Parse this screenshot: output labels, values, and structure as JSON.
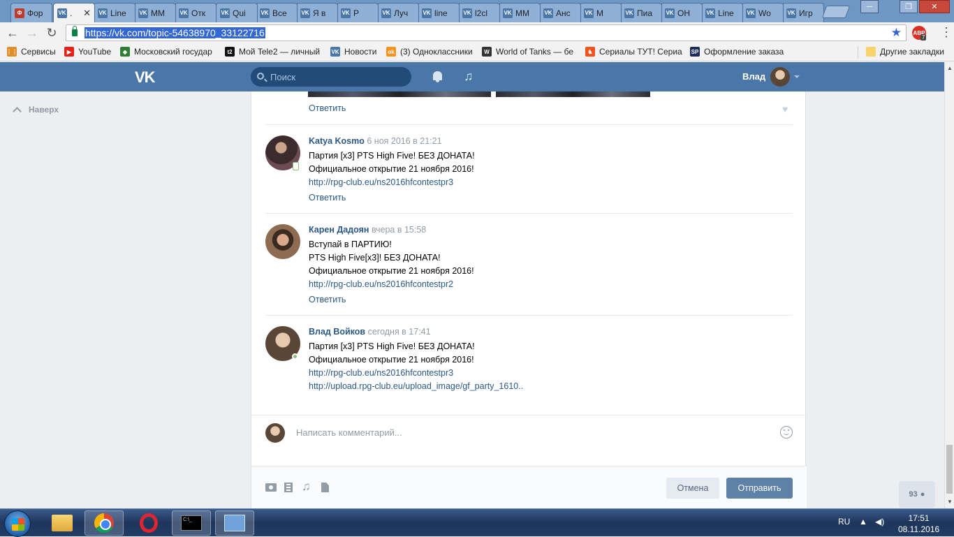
{
  "browser": {
    "tabs": [
      {
        "title": "Фор",
        "fav": "Ф"
      },
      {
        "title": ".",
        "fav": "VK",
        "active": true
      },
      {
        "title": "Line",
        "fav": "VK"
      },
      {
        "title": "MM",
        "fav": "VK"
      },
      {
        "title": "Отк",
        "fav": "VK"
      },
      {
        "title": "Qui",
        "fav": "VK"
      },
      {
        "title": "Все",
        "fav": "VK"
      },
      {
        "title": "Я в",
        "fav": "VK"
      },
      {
        "title": "Р",
        "fav": "VK"
      },
      {
        "title": "Луч",
        "fav": "VK"
      },
      {
        "title": "line",
        "fav": "VK"
      },
      {
        "title": "l2cl",
        "fav": "VK"
      },
      {
        "title": "MM",
        "fav": "VK"
      },
      {
        "title": "Анс",
        "fav": "VK"
      },
      {
        "title": "М",
        "fav": "VK"
      },
      {
        "title": "Пиа",
        "fav": "VK"
      },
      {
        "title": "ОН",
        "fav": "VK"
      },
      {
        "title": "Line",
        "fav": "VK"
      },
      {
        "title": "Wo",
        "fav": "VK"
      },
      {
        "title": "Игр",
        "fav": "VK"
      }
    ],
    "tab_close": "✕",
    "url": "https://vk.com/topic-54638970_33122716",
    "abp_label": "ABP",
    "abp_count": "7",
    "bookmarks": [
      {
        "label": "Сервисы",
        "icon": "apps-icon"
      },
      {
        "label": "YouTube",
        "icon": "youtube-icon"
      },
      {
        "label": "Московский государ",
        "icon": "msu-icon"
      },
      {
        "label": "Мой Tele2 — личный",
        "icon": "tele2-icon"
      },
      {
        "label": "Новости",
        "icon": "vk-icon"
      },
      {
        "label": "(3) Одноклассники",
        "icon": "ok-icon"
      },
      {
        "label": "World of Tanks — бе",
        "icon": "wot-icon"
      },
      {
        "label": "Сериалы ТУТ! Сериа",
        "icon": "serials-icon"
      },
      {
        "label": "Оформление заказа",
        "icon": "sp-icon"
      }
    ],
    "other_bookmarks": "Другие закладки"
  },
  "vk": {
    "logo": "VK",
    "search_placeholder": "Поиск",
    "user_name": "Влад",
    "back_up": "Наверх"
  },
  "posts": [
    {
      "reply": "Ответить"
    },
    {
      "author": "Katya Kosmo",
      "date": "6 ноя 2016 в 21:21",
      "lines": [
        "Партия [x3] PTS High Five! БЕЗ ДОНАТА!",
        "Официальное открытие 21 ноября 2016!"
      ],
      "links": [
        "http://rpg-club.eu/ns2016hfcontestpr3"
      ],
      "reply": "Ответить"
    },
    {
      "author": "Карен Дадоян",
      "date": "вчера в 15:58",
      "lines": [
        "Вступай в ПАРТИЮ!",
        "PTS High Five[x3]! БЕЗ ДОНАТА!",
        "Официальное открытие 21 ноября 2016!"
      ],
      "links": [
        "http://rpg-club.eu/ns2016hfcontestpr2"
      ],
      "reply": "Ответить"
    },
    {
      "author": "Влад Войков",
      "date": "сегодня в 17:41",
      "lines": [
        "Партия [x3] PTS High Five! БЕЗ ДОНАТА!",
        "Официальное открытие 21 ноября 2016!"
      ],
      "links": [
        "http://rpg-club.eu/ns2016hfcontestpr3",
        "http://upload.rpg-club.eu/upload_image/gf_party_1610.."
      ]
    }
  ],
  "composer": {
    "placeholder": "Написать комментарий...",
    "cancel": "Отмена",
    "send": "Отправить"
  },
  "online_count": "93",
  "taskbar": {
    "lang": "RU",
    "time": "17:51",
    "date": "08.11.2016"
  }
}
